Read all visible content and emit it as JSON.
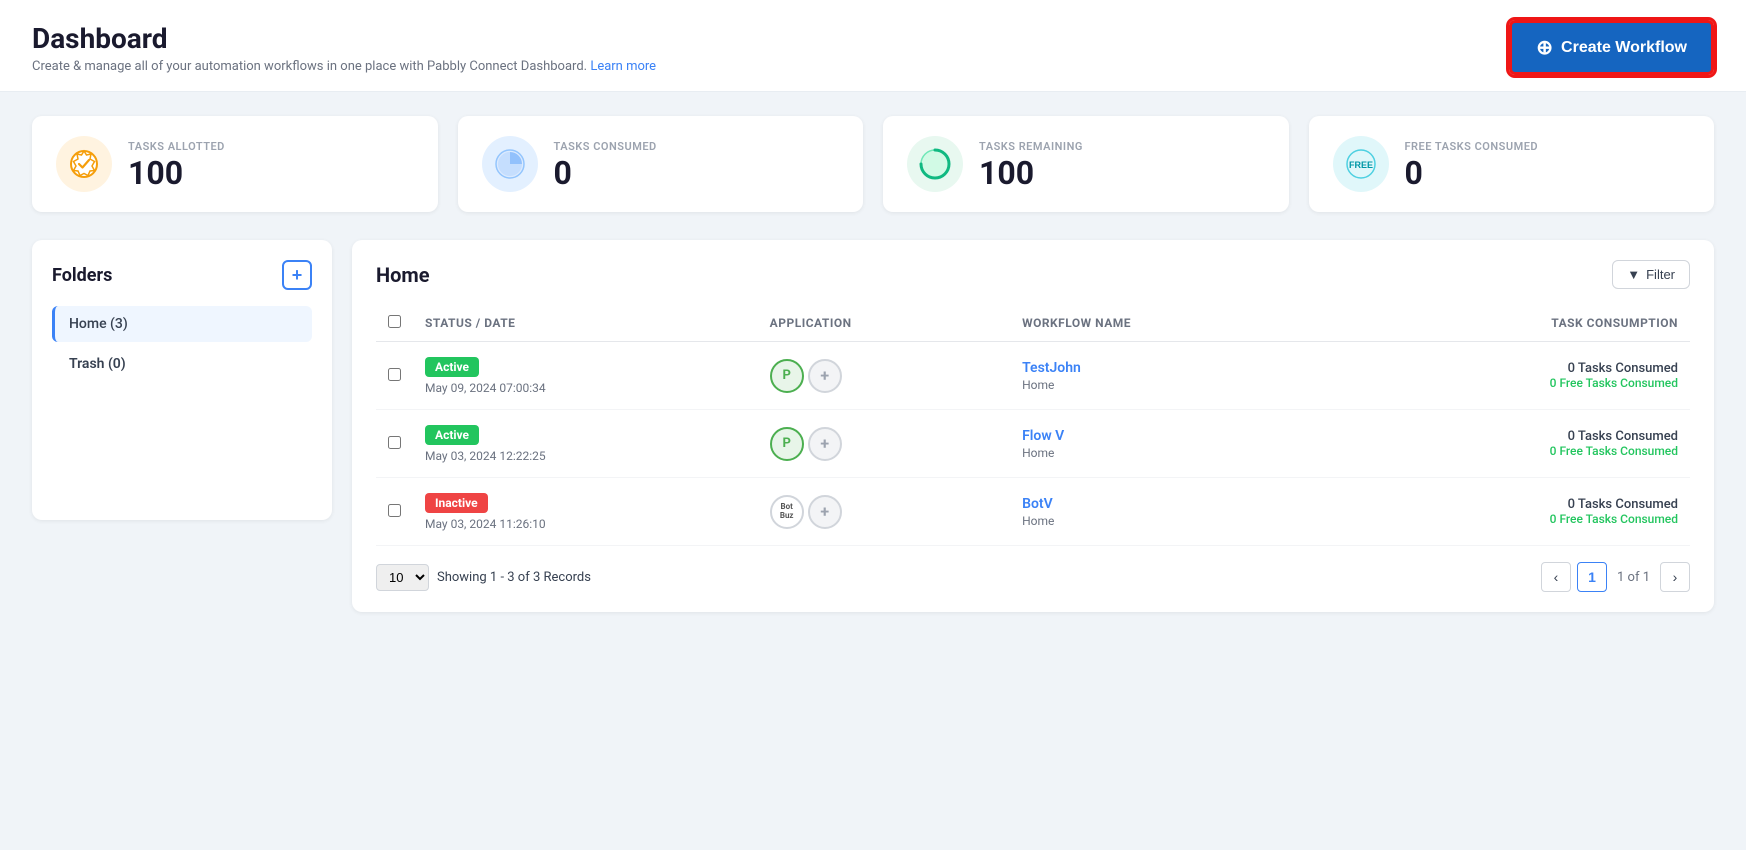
{
  "header": {
    "title": "Dashboard",
    "subtitle": "Create & manage all of your automation workflows in one place with Pabbly Connect Dashboard.",
    "learn_more": "Learn more",
    "create_workflow_btn": "Create Workflow"
  },
  "stats": [
    {
      "id": "allotted",
      "label": "TASKS ALLOTTED",
      "value": "100",
      "icon_type": "orange"
    },
    {
      "id": "consumed",
      "label": "TASKS CONSUMED",
      "value": "0",
      "icon_type": "blue"
    },
    {
      "id": "remaining",
      "label": "TASKS REMAINING",
      "value": "100",
      "icon_type": "green"
    },
    {
      "id": "free_consumed",
      "label": "FREE TASKS CONSUMED",
      "value": "0",
      "icon_type": "teal"
    }
  ],
  "folders": {
    "title": "Folders",
    "add_btn_label": "+",
    "items": [
      {
        "name": "Home",
        "count": 3,
        "active": true
      },
      {
        "name": "Trash",
        "count": 0,
        "active": false
      }
    ]
  },
  "workflows": {
    "section_title": "Home",
    "filter_btn": "Filter",
    "table_headers": [
      "STATUS / DATE",
      "APPLICATION",
      "WORKFLOW NAME",
      "TASK CONSUMPTION"
    ],
    "rows": [
      {
        "status": "Active",
        "status_type": "active",
        "date": "May 09, 2024 07:00:34",
        "app_icon": "P",
        "app_icon_type": "pabbly",
        "workflow_name": "TestJohn",
        "folder": "Home",
        "tasks_consumed": "0 Tasks Consumed",
        "free_tasks_consumed": "0 Free Tasks Consumed"
      },
      {
        "status": "Active",
        "status_type": "active",
        "date": "May 03, 2024 12:22:25",
        "app_icon": "P",
        "app_icon_type": "pabbly",
        "workflow_name": "Flow V",
        "folder": "Home",
        "tasks_consumed": "0 Tasks Consumed",
        "free_tasks_consumed": "0 Free Tasks Consumed"
      },
      {
        "status": "Inactive",
        "status_type": "inactive",
        "date": "May 03, 2024 11:26:10",
        "app_icon": "BB",
        "app_icon_type": "botbuz",
        "workflow_name": "BotV",
        "folder": "Home",
        "tasks_consumed": "0 Tasks Consumed",
        "free_tasks_consumed": "0 Free Tasks Consumed"
      }
    ],
    "pagination": {
      "per_page": "10",
      "showing_text": "Showing 1 - 3 of 3 Records",
      "current_page": "1",
      "total_pages": "1 of 1"
    }
  }
}
